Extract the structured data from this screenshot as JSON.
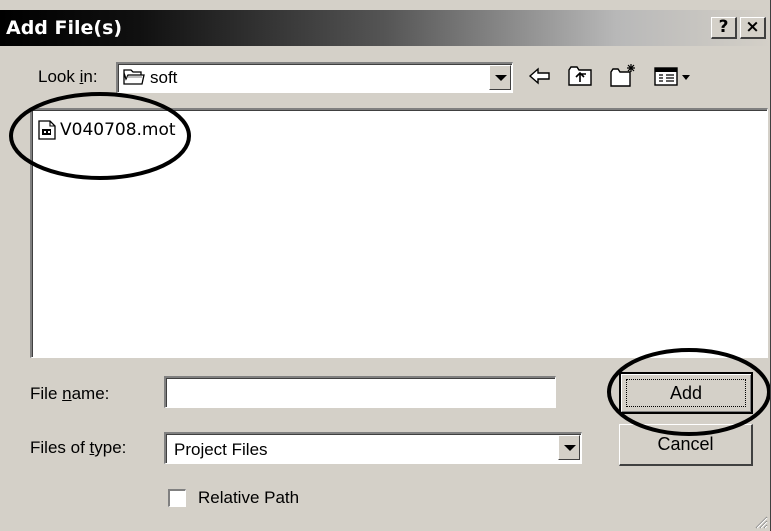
{
  "window": {
    "title": "Add File(s)",
    "help_glyph": "?",
    "close_glyph": "×"
  },
  "lookin": {
    "label_prefix": "Look ",
    "label_accel": "i",
    "label_suffix": "n:",
    "value": "soft",
    "icon": "folder-icon"
  },
  "toolbar": {
    "back_icon": "back-arrow-icon",
    "up_icon": "up-folder-icon",
    "new_folder_icon": "new-folder-icon",
    "view_icon": "view-menu-icon"
  },
  "files": [
    {
      "name": "V040708.mot",
      "icon": "file-icon"
    }
  ],
  "filename": {
    "label_prefix": "File ",
    "label_accel": "n",
    "label_suffix": "ame:",
    "value": "",
    "placeholder": ""
  },
  "filetype": {
    "label_prefix": "Files of ",
    "label_accel": "t",
    "label_suffix": "ype:",
    "value": "Project Files"
  },
  "buttons": {
    "add_label": "Add",
    "cancel_label": "Cancel"
  },
  "relative_path": {
    "label": "Relative Path",
    "checked": false
  },
  "colors": {
    "dialog_bg": "#d4d0c8",
    "title_text": "#ffffff",
    "annotation": "#000000"
  }
}
